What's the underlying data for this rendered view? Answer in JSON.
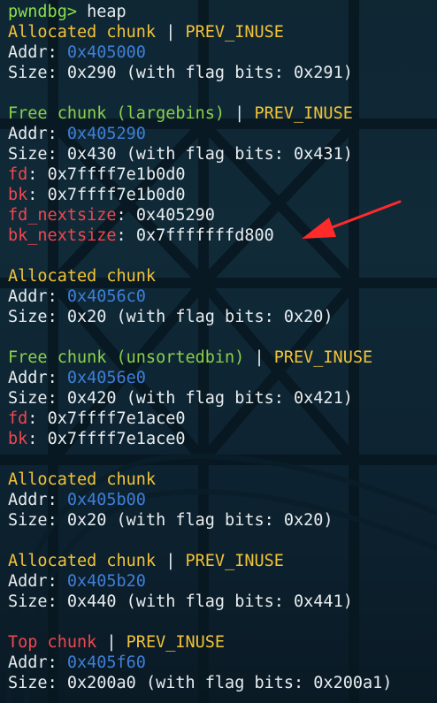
{
  "prompt": {
    "text": "pwndbg>",
    "command": " heap"
  },
  "chunks": [
    {
      "title": "Allocated chunk",
      "title_color": "#f2c338",
      "sep": " | ",
      "flag": "PREV_INUSE",
      "addr_label": "Addr",
      "addr": "0x405000",
      "size_label": "Size",
      "size_text": "0x290 (with flag bits: 0x291)"
    },
    {
      "title": "Free chunk (largebins)",
      "title_color": "#8ad04a",
      "sep": " | ",
      "flag": "PREV_INUSE",
      "addr_label": "Addr",
      "addr": "0x405290",
      "size_label": "Size",
      "size_text": "0x430 (with flag bits: 0x431)",
      "fields": [
        {
          "name": "fd",
          "value": "0x7ffff7e1b0d0"
        },
        {
          "name": "bk",
          "value": "0x7ffff7e1b0d0"
        },
        {
          "name": "fd_nextsize",
          "value": "0x405290"
        },
        {
          "name": "bk_nextsize",
          "value": "0x7fffffffd800"
        }
      ]
    },
    {
      "title": "Allocated chunk",
      "addr_label": "Addr",
      "addr": "0x4056c0",
      "size_label": "Size",
      "size_text": "0x20 (with flag bits: 0x20)"
    },
    {
      "title": "Free chunk (unsortedbin)",
      "sep": " | ",
      "flag": "PREV_INUSE",
      "addr_label": "Addr",
      "addr": "0x4056e0",
      "size_label": "Size",
      "size_text": "0x420 (with flag bits: 0x421)",
      "fields": [
        {
          "name": "fd",
          "value": "0x7ffff7e1ace0"
        },
        {
          "name": "bk",
          "value": "0x7ffff7e1ace0"
        }
      ]
    },
    {
      "title": "Allocated chunk",
      "addr_label": "Addr",
      "addr": "0x405b00",
      "size_label": "Size",
      "size_text": "0x20 (with flag bits: 0x20)"
    },
    {
      "title": "Allocated chunk",
      "sep": " | ",
      "flag": "PREV_INUSE",
      "addr_label": "Addr",
      "addr": "0x405b20",
      "size_label": "Size",
      "size_text": "0x440 (with flag bits: 0x441)"
    },
    {
      "title": "Top chunk",
      "sep": " | ",
      "flag": "PREV_INUSE",
      "addr_label": "Addr",
      "addr": "0x405f60",
      "size_label": "Size",
      "size_text": "0x200a0 (with flag bits: 0x200a1)"
    }
  ],
  "colors": {
    "prompt": "#8be04a",
    "allocated": "#f2c338",
    "free": "#8ad04a",
    "top": "#f0474f",
    "field": "#f0474f",
    "addr": "#3f7fd8",
    "text": "#e8edf0",
    "arrow": "#ff2a2a"
  },
  "annotation": {
    "type": "arrow",
    "points_to": "bk_nextsize",
    "icon": "red-arrow-icon"
  }
}
